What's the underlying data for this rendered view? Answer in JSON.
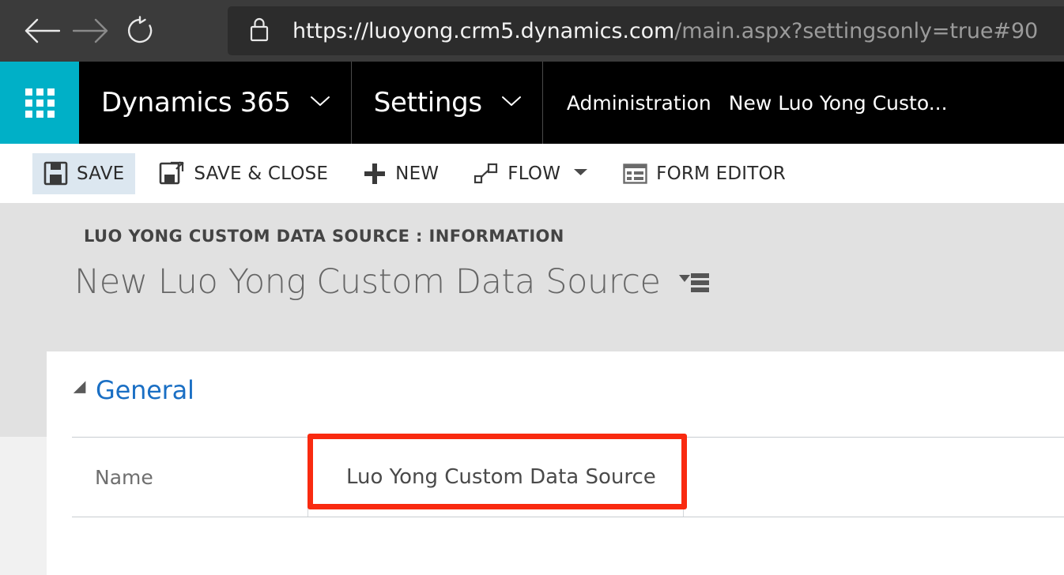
{
  "browser": {
    "back_icon": "arrow-left-icon",
    "forward_icon": "arrow-right-icon",
    "reload_icon": "reload-icon",
    "lock_icon": "lock-icon",
    "url_domain": "https://luoyong.crm5.dynamics.com",
    "url_path": "/main.aspx?settingsonly=true#90",
    "url_full": "https://luoyong.crm5.dynamics.com/main.aspx?settingsonly=true#90"
  },
  "topnav": {
    "waffle_icon": "app-launcher-waffle-icon",
    "product": "Dynamics 365",
    "product_chevron_icon": "chevron-down-icon",
    "area": "Settings",
    "area_chevron_icon": "chevron-down-icon",
    "breadcrumbs": [
      {
        "label": "Administration"
      },
      {
        "label": "New Luo Yong Custo..."
      }
    ],
    "accent_color": "#00b0c7",
    "background_color": "#000000"
  },
  "commandbar": {
    "items": [
      {
        "label": "SAVE",
        "icon": "save-disk-icon",
        "active": true,
        "caret": false
      },
      {
        "label": "SAVE & CLOSE",
        "icon": "save-and-close-icon",
        "active": false,
        "caret": false
      },
      {
        "label": "NEW",
        "icon": "plus-icon",
        "active": false,
        "caret": false
      },
      {
        "label": "FLOW",
        "icon": "flow-nodes-icon",
        "active": false,
        "caret": true
      },
      {
        "label": "FORM EDITOR",
        "icon": "form-editor-icon",
        "active": false,
        "caret": false
      }
    ],
    "active_background": "#dce7f0"
  },
  "record": {
    "entity_breadcrumb": "LUO YONG CUSTOM DATA SOURCE : INFORMATION",
    "title": "New Luo Yong Custom Data Source",
    "form_selector_icon": "form-selector-icon"
  },
  "form": {
    "section": {
      "title": "General",
      "collapse_icon": "triangle-collapse-icon",
      "title_color": "#1a6fc4"
    },
    "fields": [
      {
        "label": "Name",
        "value": "Luo Yong Custom Data Source",
        "placeholder": "",
        "highlighted": true
      }
    ]
  },
  "annotation": {
    "highlight_color": "#f92a10",
    "target": "name-field"
  }
}
